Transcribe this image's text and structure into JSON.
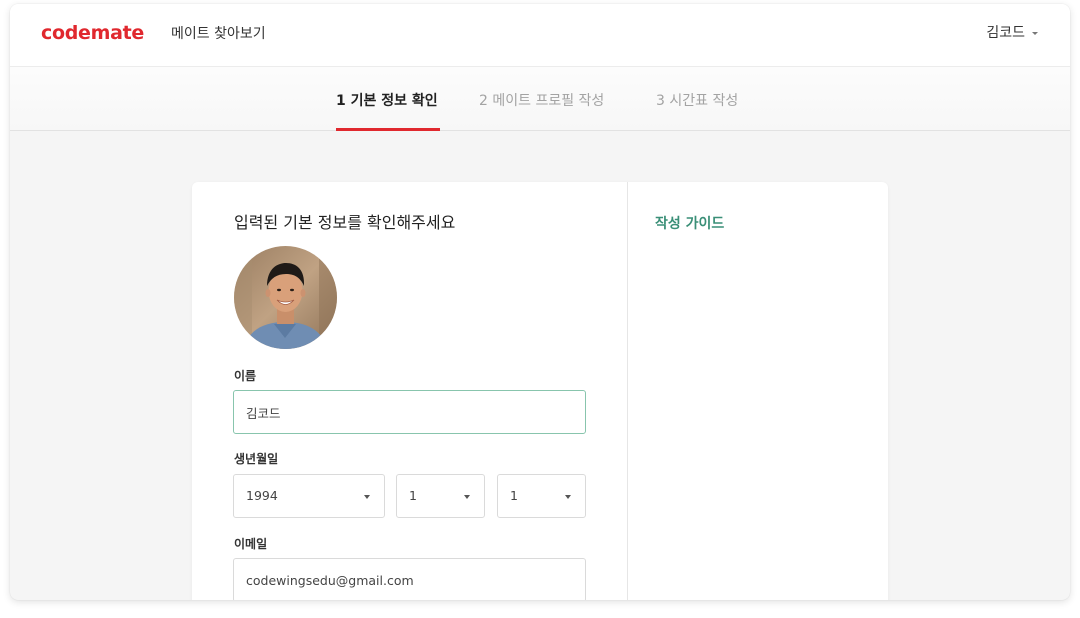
{
  "colors": {
    "brand": "#e0282e",
    "accent_green": "#3a8f77",
    "step_underline": "#e0282e",
    "focus_border": "#88c5ad"
  },
  "header": {
    "logo": "codemate",
    "nav_link": "메이트 찾아보기",
    "user_name": "김코드",
    "user_menu_icon": "caret-down-icon"
  },
  "steps": [
    {
      "label": "1  기본 정보 확인",
      "state": "active"
    },
    {
      "label": "2  메이트 프로필 작성",
      "state": "inactive"
    },
    {
      "label": "3  시간표 작성",
      "state": "inactive"
    }
  ],
  "form": {
    "title": "입력된 기본 정보를 확인해주세요",
    "avatar_alt": "profile-photo",
    "name_label": "이름",
    "name_value": "김코드",
    "birth_label": "생년월일",
    "birth_year": "1994",
    "birth_month": "1",
    "birth_day": "1",
    "email_label": "이메일",
    "email_value": "codewingsedu@gmail.com"
  },
  "guide": {
    "title": "작성 가이드"
  }
}
